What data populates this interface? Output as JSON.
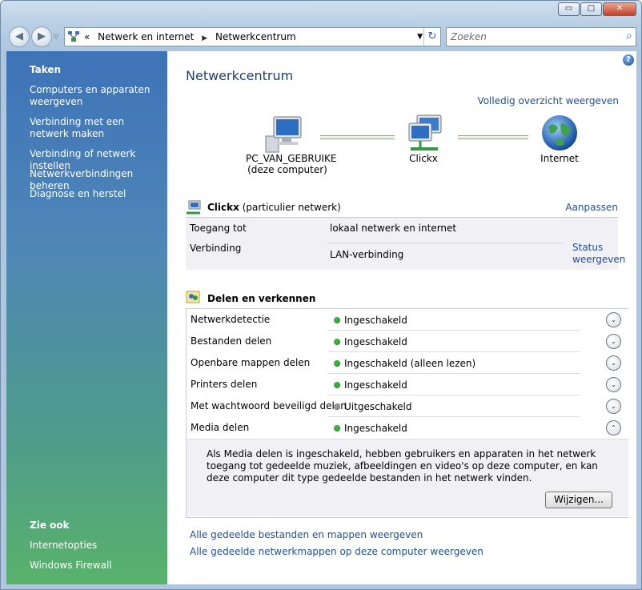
{
  "window": {
    "min_glyph": "▭",
    "max_glyph": "□",
    "close_glyph": "✕"
  },
  "nav": {
    "back_glyph": "◀",
    "forward_glyph": "▶",
    "history_glyph": "▽",
    "address": {
      "prefix": "«",
      "crumb1": "Netwerk en internet",
      "sep": "▶",
      "crumb2": "Netwerkcentrum",
      "dropdown_glyph": "▼",
      "refresh_glyph": "↻"
    },
    "search": {
      "placeholder": "Zoeken",
      "icon_glyph": "⌕"
    }
  },
  "sidebar": {
    "tasks_heading": "Taken",
    "tasks": [
      "Computers en apparaten weergeven",
      "Verbinding met een netwerk maken",
      "Verbinding of netwerk instellen",
      "Netwerkverbindingen beheren",
      "Diagnose en herstel"
    ],
    "see_also_heading": "Zie ook",
    "see_also": [
      "Internetopties",
      "Windows Firewall"
    ]
  },
  "main": {
    "help_glyph": "?",
    "title": "Netwerkcentrum",
    "full_map_link": "Volledig overzicht weergeven",
    "map": {
      "computer_name": "PC_VAN_GEBRUIKE",
      "computer_sub": "(deze computer)",
      "network_name": "Clickx",
      "internet_name": "Internet"
    },
    "network": {
      "name": "Clickx",
      "type": "(particulier netwerk)",
      "customize_link": "Aanpassen",
      "access_label": "Toegang tot",
      "access_value": "lokaal netwerk en internet",
      "connection_label": "Verbinding",
      "connection_value": "LAN-verbinding",
      "status_link_line1": "Status",
      "status_link_line2": "weergeven"
    },
    "sharing": {
      "heading": "Delen en verkennen",
      "rows": [
        {
          "label": "Netwerkdetectie",
          "value": "Ingeschakeld",
          "state": "on",
          "expander": "⌄"
        },
        {
          "label": "Bestanden delen",
          "value": "Ingeschakeld",
          "state": "on",
          "expander": "⌄"
        },
        {
          "label": "Openbare mappen delen",
          "value": "Ingeschakeld (alleen lezen)",
          "state": "on",
          "expander": "⌄"
        },
        {
          "label": "Printers delen",
          "value": "Ingeschakeld",
          "state": "on",
          "expander": "⌄"
        },
        {
          "label": "Met wachtwoord beveiligd delen",
          "value": "Uitgeschakeld",
          "state": "off",
          "expander": "⌄"
        },
        {
          "label": "Media delen",
          "value": "Ingeschakeld",
          "state": "on",
          "expander": "⌃"
        }
      ],
      "media_description": "Als Media delen is ingeschakeld, hebben gebruikers en apparaten in het netwerk toegang tot gedeelde muziek, afbeeldingen en video's op deze computer, en kan deze computer dit type gedeelde bestanden in het netwerk vinden.",
      "change_button": "Wijzigen..."
    },
    "bottom_links": [
      "Alle gedeelde bestanden en mappen weergeven",
      "Alle gedeelde netwerkmappen op deze computer weergeven"
    ]
  },
  "colors": {
    "status_on": "#3bb63b",
    "status_off": "#9a9a9a",
    "link": "#1f4fa0"
  }
}
